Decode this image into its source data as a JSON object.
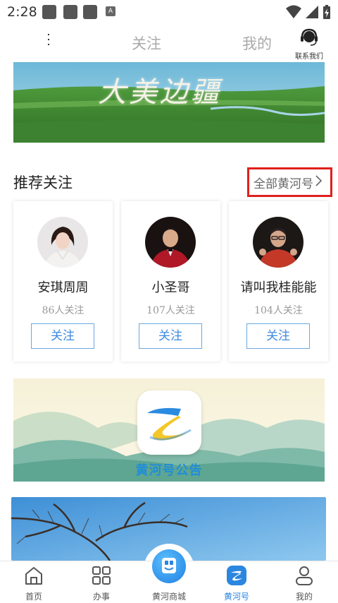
{
  "status_bar": {
    "time": "2:28",
    "notif_letter": "A"
  },
  "header": {
    "tabs": [
      {
        "label": "关注"
      },
      {
        "label": "我的"
      }
    ],
    "contact_label": "联系我们"
  },
  "banner": {
    "title": "大美边疆"
  },
  "recommend": {
    "title": "推荐关注",
    "all_link": "全部黄河号",
    "cards": [
      {
        "name": "安琪周周",
        "count": "86人关注",
        "follow_label": "关注"
      },
      {
        "name": "小圣哥",
        "count": "107人关注",
        "follow_label": "关注"
      },
      {
        "name": "请叫我桂能能",
        "count": "104人关注",
        "follow_label": "关注"
      }
    ]
  },
  "announce": {
    "text": "黄河号公告"
  },
  "bottom_nav": [
    {
      "label": "首页",
      "icon": "home-icon"
    },
    {
      "label": "办事",
      "icon": "grid-icon"
    },
    {
      "label": "黄河商城",
      "icon": "mall-icon"
    },
    {
      "label": "黄河号",
      "icon": "huanghe-icon",
      "active": true
    },
    {
      "label": "我的",
      "icon": "person-icon"
    }
  ],
  "colors": {
    "accent": "#2b86e0",
    "highlight_box": "#e0201c",
    "follow_border": "#6aa8e0"
  }
}
